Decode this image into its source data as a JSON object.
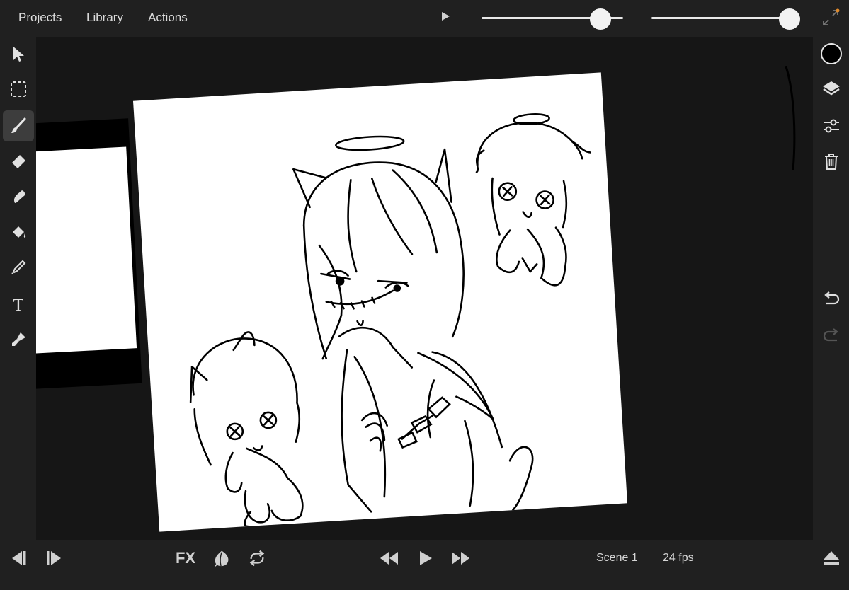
{
  "menu": {
    "projects": "Projects",
    "library": "Library",
    "actions": "Actions"
  },
  "top": {
    "slider1_level": 0.84,
    "slider2_level": 0.93
  },
  "colors": {
    "current_color": "#000000",
    "accent": "#e6e6e6"
  },
  "left_tools": [
    "select-icon",
    "marquee-icon",
    "brush-icon",
    "eraser-icon",
    "smudge-icon",
    "fill-icon",
    "eyedropper-icon",
    "text-icon",
    "pen-icon"
  ],
  "right_tools": [
    "color-swatch",
    "layers-icon",
    "adjust-icon",
    "trash-icon",
    "undo-icon",
    "redo-icon"
  ],
  "bottom": {
    "fx_label": "FX",
    "scene": "Scene 1",
    "fps": "24 fps"
  }
}
